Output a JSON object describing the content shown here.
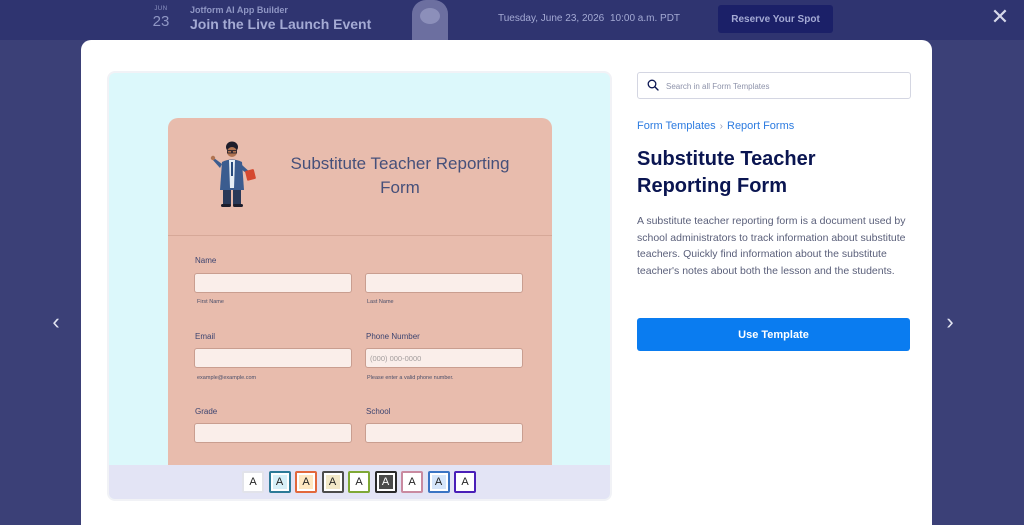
{
  "banner": {
    "month": "JUN",
    "day": "23",
    "subtitle": "Jotform AI App Builder",
    "title": "Join the Live Launch Event",
    "date": "Tuesday, June 23, 2026",
    "time": "10:00 a.m. PDT",
    "cta_label": "Reserve Your Spot"
  },
  "close_icon": "✕",
  "nav": {
    "prev_icon": "‹",
    "next_icon": "›"
  },
  "search": {
    "placeholder": "Search in all Form Templates",
    "value": ""
  },
  "breadcrumb": {
    "items": [
      "Form Templates",
      "Report Forms"
    ],
    "separator": "›"
  },
  "template": {
    "title": "Substitute Teacher Reporting Form",
    "description": "A substitute teacher reporting form is a document used by school administrators to track information about substitute teachers. Quickly find information about the substitute teacher's notes about both the lesson and the students.",
    "use_label": "Use Template"
  },
  "preview": {
    "form_title": "Substitute Teacher Reporting Form",
    "fields": {
      "name_label": "Name",
      "first_name_hint": "First Name",
      "last_name_hint": "Last Name",
      "email_label": "Email",
      "email_hint": "example@example.com",
      "phone_label": "Phone Number",
      "phone_placeholder": "(000) 000-0000",
      "phone_hint": "Please enter a valid phone number.",
      "grade_label": "Grade",
      "school_label": "School"
    },
    "themes": [
      {
        "label": "A",
        "border": "#e2e3ea",
        "fill": "#ffffff",
        "text": "#222222"
      },
      {
        "label": "A",
        "border": "#2d7a97",
        "fill": "#d7f0f8",
        "text": "#222222"
      },
      {
        "label": "A",
        "border": "#e2683c",
        "fill": "#ffe8c2",
        "text": "#222222"
      },
      {
        "label": "A",
        "border": "#4c4c4c",
        "fill": "#f2e8c8",
        "text": "#222222"
      },
      {
        "label": "A",
        "border": "#7fa836",
        "fill": "#ffffff",
        "text": "#222222"
      },
      {
        "label": "A",
        "border": "#2a2a2a",
        "fill": "#4a4a4a",
        "text": "#ffffff"
      },
      {
        "label": "A",
        "border": "#c98aa0",
        "fill": "#ffffff",
        "text": "#222222"
      },
      {
        "label": "A",
        "border": "#3b74c4",
        "fill": "#d6e6fb",
        "text": "#222222"
      },
      {
        "label": "A",
        "border": "#4a1fb8",
        "fill": "#ffffff",
        "text": "#222222"
      }
    ]
  },
  "colors": {
    "accent": "#0a7cf0",
    "title": "#0a1551",
    "form_bg": "#e8bcad",
    "preview_bg": "#dcf8fb"
  }
}
